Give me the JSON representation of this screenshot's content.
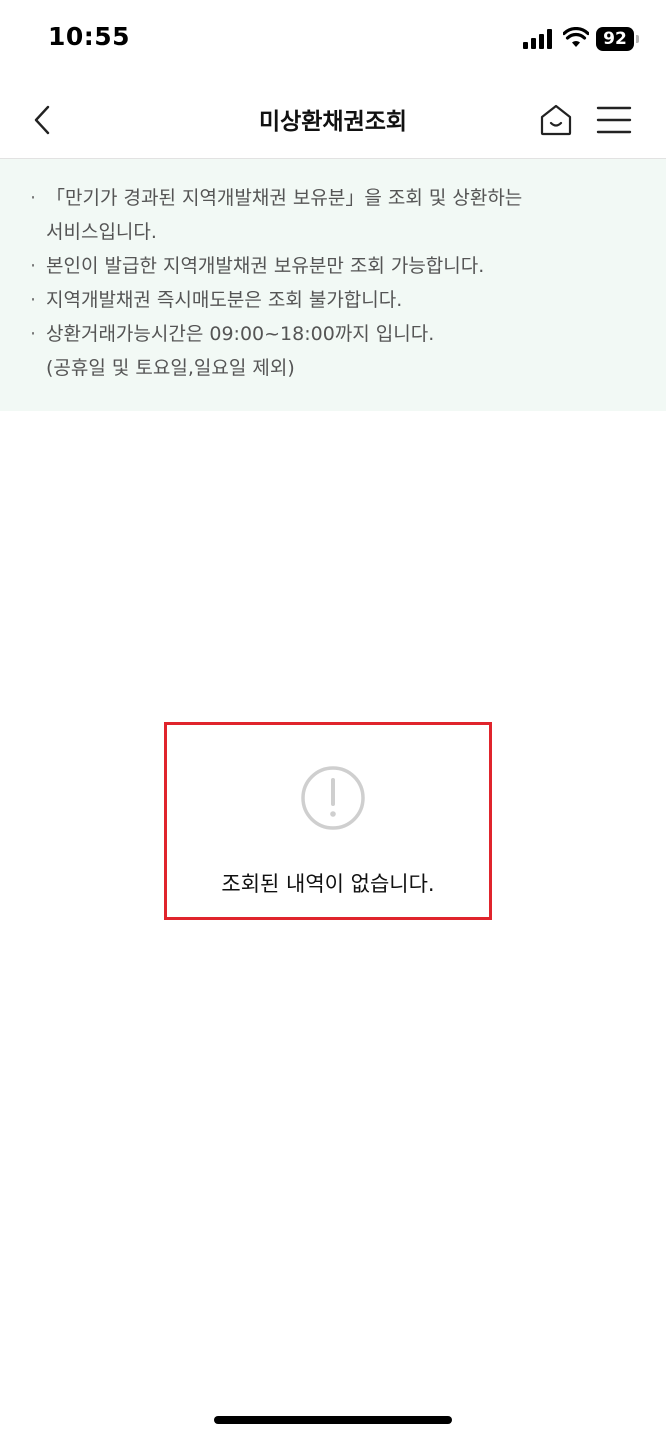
{
  "status_bar": {
    "time": "10:55",
    "battery": "92"
  },
  "header": {
    "title": "미상환채권조회",
    "back_icon": "chevron-left-icon",
    "home_icon": "home-icon",
    "menu_icon": "hamburger-menu-icon"
  },
  "notice": {
    "items": [
      {
        "lines": [
          "「만기가 경과된 지역개발채권 보유분」을 조회 및 상환하는",
          "서비스입니다."
        ]
      },
      {
        "lines": [
          "본인이 발급한 지역개발채권 보유분만 조회 가능합니다."
        ]
      },
      {
        "lines": [
          "지역개발채권 즉시매도분은 조회 불가합니다."
        ]
      },
      {
        "lines": [
          "상환거래가능시간은 09:00~18:00까지 입니다.",
          "(공휴일 및 토요일,일요일 제외)"
        ]
      }
    ]
  },
  "empty_state": {
    "icon": "exclamation-circle-icon",
    "message": "조회된 내역이 없습니다."
  },
  "colors": {
    "notice_bg": "#f2f9f5",
    "highlight_border": "#e0242c"
  }
}
